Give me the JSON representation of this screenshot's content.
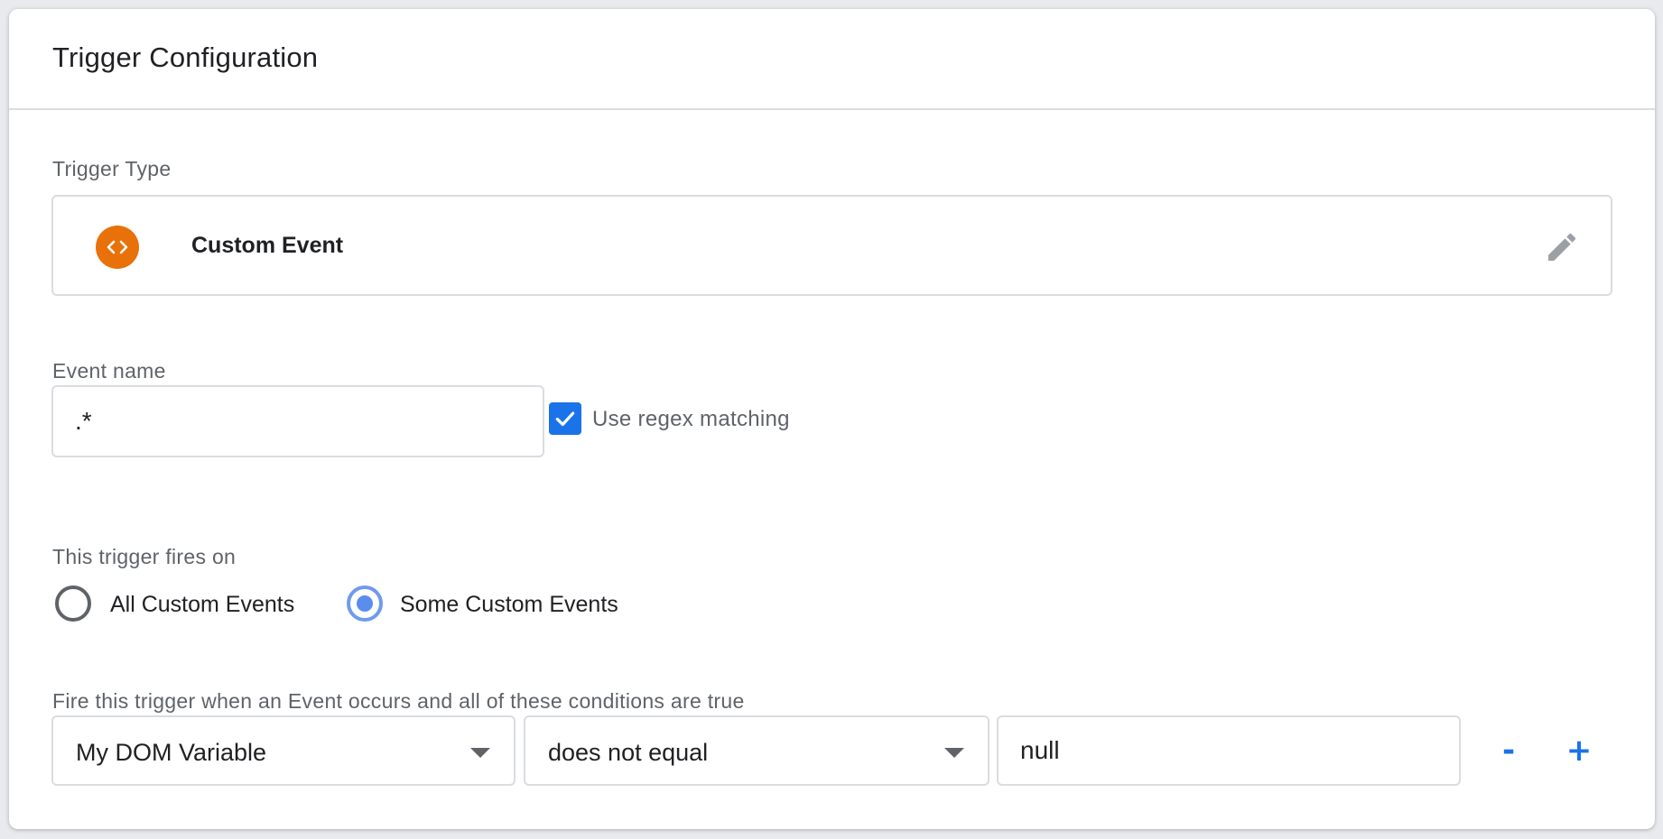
{
  "header": {
    "title": "Trigger Configuration"
  },
  "trigger_type": {
    "label": "Trigger Type",
    "name": "Custom Event",
    "icon": "code-brackets-icon",
    "icon_color": "#e8710a"
  },
  "event_name": {
    "label": "Event name",
    "value": ".*",
    "regex_checked": true,
    "regex_label": "Use regex matching"
  },
  "fires_on": {
    "label": "This trigger fires on",
    "options": [
      {
        "label": "All Custom Events",
        "selected": false
      },
      {
        "label": "Some Custom Events",
        "selected": true
      }
    ]
  },
  "conditions": {
    "label": "Fire this trigger when an Event occurs and all of these conditions are true",
    "variable": "My DOM Variable",
    "operator": "does not equal",
    "value": "null",
    "remove_label": "-",
    "add_label": "+"
  },
  "colors": {
    "accent": "#1a73e8",
    "icon_bg": "#e8710a"
  }
}
